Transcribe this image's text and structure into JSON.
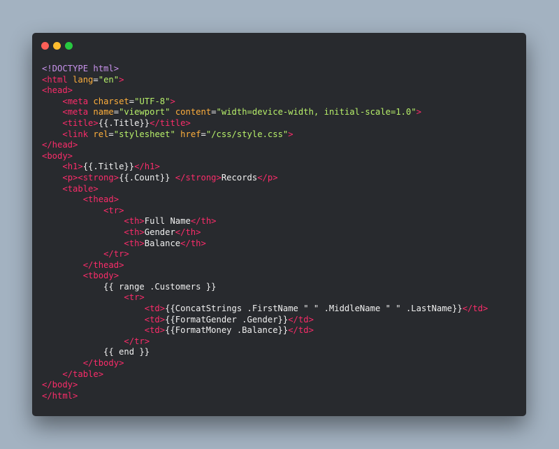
{
  "window": {
    "controls": [
      {
        "name": "close-dot",
        "color": "#fe5f57"
      },
      {
        "name": "minimize-dot",
        "color": "#febc2e"
      },
      {
        "name": "maximize-dot",
        "color": "#27c840"
      }
    ]
  },
  "code": {
    "colors": {
      "background": "#282a2e",
      "doctype": "#c792ea",
      "tag": "#fb2c6a",
      "attribute": "#fdae3c",
      "string": "#b7ef6a",
      "text": "#f0f0f0"
    },
    "lines": [
      [
        [
          "doctype",
          "<!DOCTYPE html>"
        ]
      ],
      [
        [
          "tag",
          "<html"
        ],
        [
          "text",
          " "
        ],
        [
          "attr",
          "lang"
        ],
        [
          "eq",
          "="
        ],
        [
          "string",
          "\"en\""
        ],
        [
          "tag",
          ">"
        ]
      ],
      [
        [
          "tag",
          "<head>"
        ]
      ],
      [
        [
          "text",
          "    "
        ],
        [
          "tag",
          "<meta"
        ],
        [
          "text",
          " "
        ],
        [
          "attr",
          "charset"
        ],
        [
          "eq",
          "="
        ],
        [
          "string",
          "\"UTF-8\""
        ],
        [
          "tag",
          ">"
        ]
      ],
      [
        [
          "text",
          "    "
        ],
        [
          "tag",
          "<meta"
        ],
        [
          "text",
          " "
        ],
        [
          "attr",
          "name"
        ],
        [
          "eq",
          "="
        ],
        [
          "string",
          "\"viewport\""
        ],
        [
          "text",
          " "
        ],
        [
          "attr",
          "content"
        ],
        [
          "eq",
          "="
        ],
        [
          "string",
          "\"width=device-width, initial-scale=1.0\""
        ],
        [
          "tag",
          ">"
        ]
      ],
      [
        [
          "text",
          "    "
        ],
        [
          "tag",
          "<title>"
        ],
        [
          "text",
          "{{.Title}}"
        ],
        [
          "tag",
          "</title>"
        ]
      ],
      [
        [
          "text",
          "    "
        ],
        [
          "tag",
          "<link"
        ],
        [
          "text",
          " "
        ],
        [
          "attr",
          "rel"
        ],
        [
          "eq",
          "="
        ],
        [
          "string",
          "\"stylesheet\""
        ],
        [
          "text",
          " "
        ],
        [
          "attr",
          "href"
        ],
        [
          "eq",
          "="
        ],
        [
          "string",
          "\"/css/style.css\""
        ],
        [
          "tag",
          ">"
        ]
      ],
      [
        [
          "tag",
          "</head>"
        ]
      ],
      [
        [
          "tag",
          "<body>"
        ]
      ],
      [
        [
          "text",
          "    "
        ],
        [
          "tag",
          "<h1>"
        ],
        [
          "text",
          "{{.Title}}"
        ],
        [
          "tag",
          "</h1>"
        ]
      ],
      [
        [
          "text",
          "    "
        ],
        [
          "tag",
          "<p><strong>"
        ],
        [
          "text",
          "{{.Count}} "
        ],
        [
          "tag",
          "</strong>"
        ],
        [
          "text",
          "Records"
        ],
        [
          "tag",
          "</p>"
        ]
      ],
      [
        [
          "text",
          "    "
        ],
        [
          "tag",
          "<table>"
        ]
      ],
      [
        [
          "text",
          "        "
        ],
        [
          "tag",
          "<thead>"
        ]
      ],
      [
        [
          "text",
          "            "
        ],
        [
          "tag",
          "<tr>"
        ]
      ],
      [
        [
          "text",
          "                "
        ],
        [
          "tag",
          "<th>"
        ],
        [
          "text",
          "Full Name"
        ],
        [
          "tag",
          "</th>"
        ]
      ],
      [
        [
          "text",
          "                "
        ],
        [
          "tag",
          "<th>"
        ],
        [
          "text",
          "Gender"
        ],
        [
          "tag",
          "</th>"
        ]
      ],
      [
        [
          "text",
          "                "
        ],
        [
          "tag",
          "<th>"
        ],
        [
          "text",
          "Balance"
        ],
        [
          "tag",
          "</th>"
        ]
      ],
      [
        [
          "text",
          "            "
        ],
        [
          "tag",
          "</tr>"
        ]
      ],
      [
        [
          "text",
          "        "
        ],
        [
          "tag",
          "</thead>"
        ]
      ],
      [
        [
          "text",
          "        "
        ],
        [
          "tag",
          "<tbody>"
        ]
      ],
      [
        [
          "text",
          "            {{ range .Customers }}"
        ]
      ],
      [
        [
          "text",
          "                "
        ],
        [
          "tag",
          "<tr>"
        ]
      ],
      [
        [
          "text",
          "                    "
        ],
        [
          "tag",
          "<td>"
        ],
        [
          "text",
          "{{ConcatStrings .FirstName \" \" .MiddleName \" \" .LastName}}"
        ],
        [
          "tag",
          "</td>"
        ]
      ],
      [
        [
          "text",
          "                    "
        ],
        [
          "tag",
          "<td>"
        ],
        [
          "text",
          "{{FormatGender .Gender}}"
        ],
        [
          "tag",
          "</td>"
        ]
      ],
      [
        [
          "text",
          "                    "
        ],
        [
          "tag",
          "<td>"
        ],
        [
          "text",
          "{{FormatMoney .Balance}}"
        ],
        [
          "tag",
          "</td>"
        ]
      ],
      [
        [
          "text",
          "                "
        ],
        [
          "tag",
          "</tr>"
        ]
      ],
      [
        [
          "text",
          "            {{ end }}"
        ]
      ],
      [
        [
          "text",
          "        "
        ],
        [
          "tag",
          "</tbody>"
        ]
      ],
      [
        [
          "text",
          "    "
        ],
        [
          "tag",
          "</table>"
        ]
      ],
      [
        [
          "tag",
          "</body>"
        ]
      ],
      [
        [
          "tag",
          "</html>"
        ]
      ]
    ]
  }
}
